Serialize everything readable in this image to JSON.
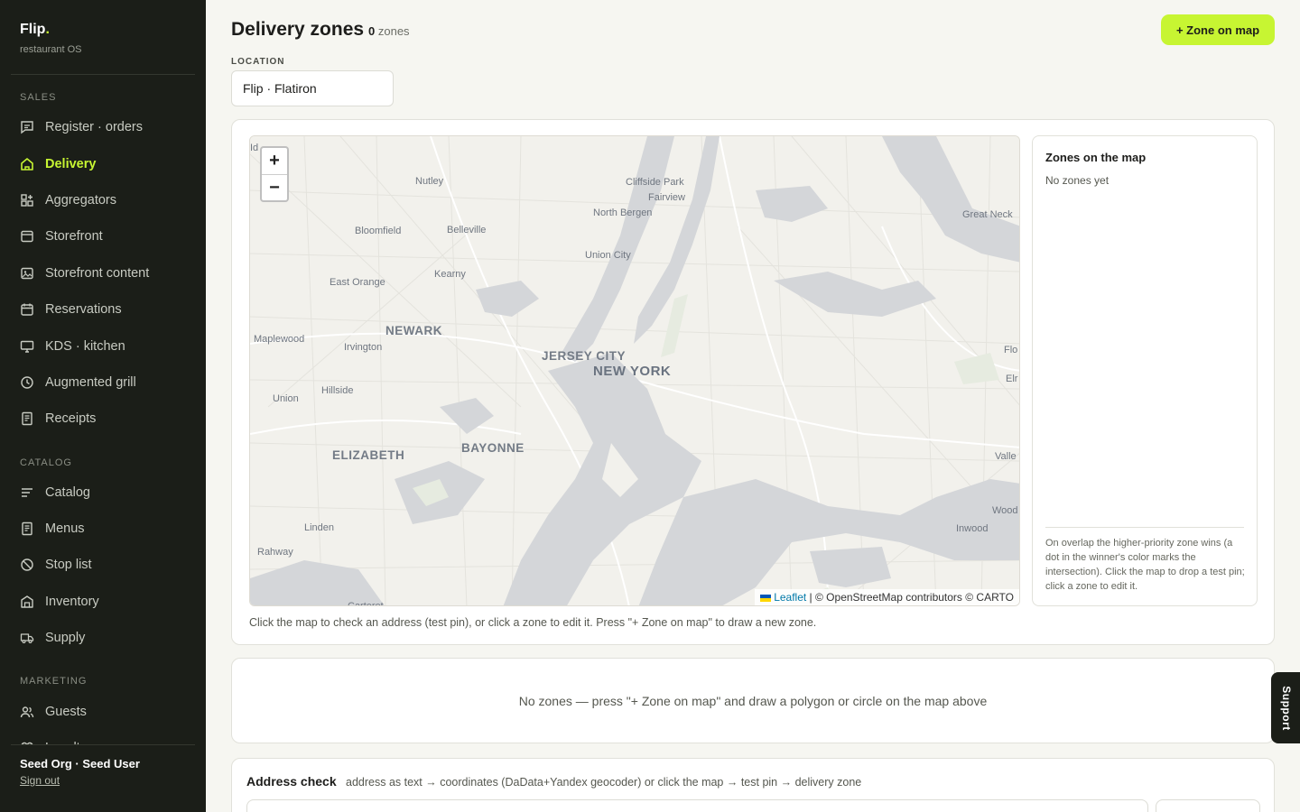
{
  "brand": {
    "name": "Flip",
    "dot": ".",
    "subtitle": "restaurant OS"
  },
  "sidebar": {
    "sections": [
      {
        "label": "SALES",
        "items": [
          {
            "label": "Register · orders",
            "icon": "receipt-chat-icon"
          },
          {
            "label": "Delivery",
            "icon": "home-icon",
            "active": true
          },
          {
            "label": "Aggregators",
            "icon": "grid-plus-icon"
          },
          {
            "label": "Storefront",
            "icon": "browser-window-icon"
          },
          {
            "label": "Storefront content",
            "icon": "image-icon"
          },
          {
            "label": "Reservations",
            "icon": "calendar-icon"
          },
          {
            "label": "KDS · kitchen",
            "icon": "monitor-icon"
          },
          {
            "label": "Augmented grill",
            "icon": "clock-icon"
          },
          {
            "label": "Receipts",
            "icon": "document-icon"
          }
        ]
      },
      {
        "label": "CATALOG",
        "items": [
          {
            "label": "Catalog",
            "icon": "list-icon"
          },
          {
            "label": "Menus",
            "icon": "document-icon"
          },
          {
            "label": "Stop list",
            "icon": "ban-icon"
          },
          {
            "label": "Inventory",
            "icon": "warehouse-icon"
          },
          {
            "label": "Supply",
            "icon": "truck-icon"
          }
        ]
      },
      {
        "label": "MARKETING",
        "items": [
          {
            "label": "Guests",
            "icon": "users-icon"
          },
          {
            "label": "Loyalty",
            "icon": "heart-icon"
          }
        ]
      }
    ],
    "footer": {
      "user": "Seed Org · Seed User",
      "signout": "Sign out"
    }
  },
  "header": {
    "title": "Delivery zones",
    "count": "0",
    "count_suffix": "zones",
    "zone_button": "+ Zone on map"
  },
  "location": {
    "label": "LOCATION",
    "value": "Flip · Flatiron"
  },
  "map": {
    "zoom_in": "+",
    "zoom_out": "−",
    "attribution_leaflet": "Leaflet",
    "attribution_rest": " | © OpenStreetMap contributors © CARTO",
    "labels": [
      {
        "text": "Nutley",
        "size": "normal"
      },
      {
        "text": "Cliffside Park",
        "size": "normal"
      },
      {
        "text": "Fairview",
        "size": "normal"
      },
      {
        "text": "North Bergen",
        "size": "normal"
      },
      {
        "text": "Great Neck",
        "size": "normal"
      },
      {
        "text": "Bloomfield",
        "size": "normal"
      },
      {
        "text": "Belleville",
        "size": "normal"
      },
      {
        "text": "Union City",
        "size": "normal"
      },
      {
        "text": "Kearny",
        "size": "normal"
      },
      {
        "text": "East Orange",
        "size": "normal"
      },
      {
        "text": "NEWARK",
        "size": "big"
      },
      {
        "text": "Maplewood",
        "size": "normal"
      },
      {
        "text": "Irvington",
        "size": "normal"
      },
      {
        "text": "JERSEY CITY",
        "size": "big"
      },
      {
        "text": "NEW YORK",
        "size": "xl"
      },
      {
        "text": "Hillside",
        "size": "normal"
      },
      {
        "text": "Union",
        "size": "normal"
      },
      {
        "text": "ELIZABETH",
        "size": "big"
      },
      {
        "text": "BAYONNE",
        "size": "big"
      },
      {
        "text": "Linden",
        "size": "normal"
      },
      {
        "text": "Rahway",
        "size": "normal"
      },
      {
        "text": "Inwood",
        "size": "normal"
      },
      {
        "text": "Flo",
        "size": "normal"
      },
      {
        "text": "Elr",
        "size": "normal"
      },
      {
        "text": "Valle",
        "size": "normal"
      },
      {
        "text": "Wood",
        "size": "normal"
      },
      {
        "text": "Id",
        "size": "normal"
      },
      {
        "text": "Carteret",
        "size": "normal"
      }
    ],
    "hint": "Click the map to check an address (test pin), or click a zone to edit it. Press \"+ Zone on map\" to draw a new zone."
  },
  "zones_panel": {
    "title": "Zones on the map",
    "empty": "No zones yet",
    "note": "On overlap the higher-priority zone wins (a dot in the winner's color marks the intersection). Click the map to drop a test pin; click a zone to edit it."
  },
  "empty_state": "No zones — press \"+ Zone on map\" and draw a polygon or circle on the map above",
  "address_check": {
    "title": "Address check",
    "subtitle": "address as text → coordinates (DaData+Yandex geocoder) or click the map → test pin → delivery zone"
  },
  "support": "Support",
  "colors": {
    "accent": "#c7f532",
    "sidebar_bg": "#1b1e18",
    "water": "#d4d6d9"
  }
}
